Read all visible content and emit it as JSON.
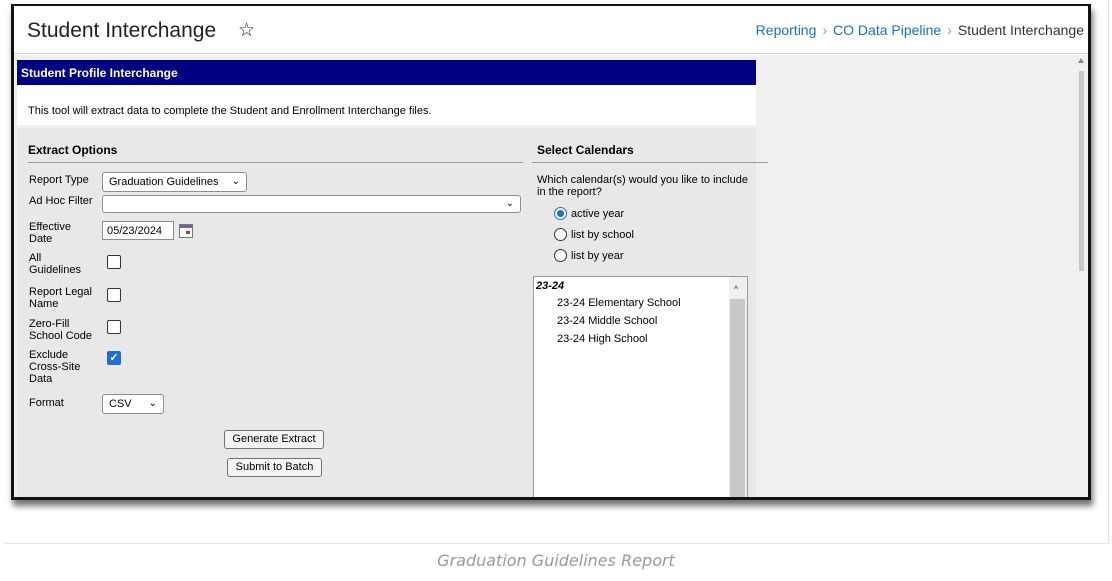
{
  "page": {
    "title": "Student Interchange",
    "breadcrumb": [
      "Reporting",
      "CO Data Pipeline",
      "Student Interchange"
    ]
  },
  "tool": {
    "header": "Student Profile Interchange",
    "description": "This tool will extract data to complete the Student and Enrollment Interchange files."
  },
  "extract_options": {
    "title": "Extract Options",
    "report_type_label": "Report Type",
    "report_type_value": "Graduation Guidelines",
    "ad_hoc_label": "Ad Hoc Filter",
    "ad_hoc_value": "",
    "effective_date_label": [
      "Effective",
      "Date"
    ],
    "effective_date_value": "05/23/2024",
    "all_guidelines_label": [
      "All",
      "Guidelines"
    ],
    "all_guidelines_checked": false,
    "report_legal_name_label": [
      "Report Legal",
      "Name"
    ],
    "report_legal_name_checked": false,
    "zero_fill_label": [
      "Zero-Fill",
      "School Code"
    ],
    "zero_fill_checked": false,
    "exclude_cross_site_label": [
      "Exclude",
      "Cross-Site",
      "Data"
    ],
    "exclude_cross_site_checked": true,
    "format_label": "Format",
    "format_value": "CSV",
    "generate_button": "Generate Extract",
    "batch_button": "Submit to Batch"
  },
  "calendars": {
    "title": "Select Calendars",
    "question": [
      "Which calendar(s) would you like to include",
      "in the report?"
    ],
    "options": [
      "active year",
      "list by school",
      "list by year"
    ],
    "selected_option": "active year",
    "group": "23-24",
    "items": [
      "23-24 Elementary School",
      "23-24 Middle School",
      "23-24 High School"
    ]
  },
  "caption": "Graduation Guidelines Report",
  "colors": {
    "header_bar": "#000080",
    "link": "#1f6fb5",
    "accent": "#1f6fd0"
  }
}
